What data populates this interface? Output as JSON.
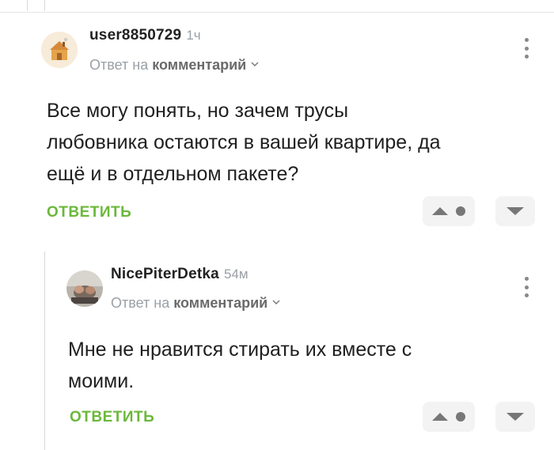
{
  "comments": [
    {
      "username": "user8850729",
      "time": "1ч",
      "reply_prefix": "Ответ на",
      "reply_target": "комментарий",
      "text_lines": [
        "Все могу понять, но зачем трусы",
        "любовника остаются в вашей квартире, да",
        "ещё и в отдельном пакете?"
      ],
      "reply_label": "ОТВЕТИТЬ",
      "avatar_icon": "house-avatar"
    },
    {
      "username": "NicePiterDetka",
      "time": "54м",
      "reply_prefix": "Ответ на",
      "reply_target": "комментарий",
      "text_lines": [
        "Мне не нравится стирать их вместе с",
        "моими."
      ],
      "reply_label": "ОТВЕТИТЬ",
      "avatar_icon": "photo-avatar"
    }
  ],
  "colors": {
    "accent_green": "#6bb83a",
    "muted": "#9aa0a6",
    "vote_bg": "#f3f3f3"
  }
}
